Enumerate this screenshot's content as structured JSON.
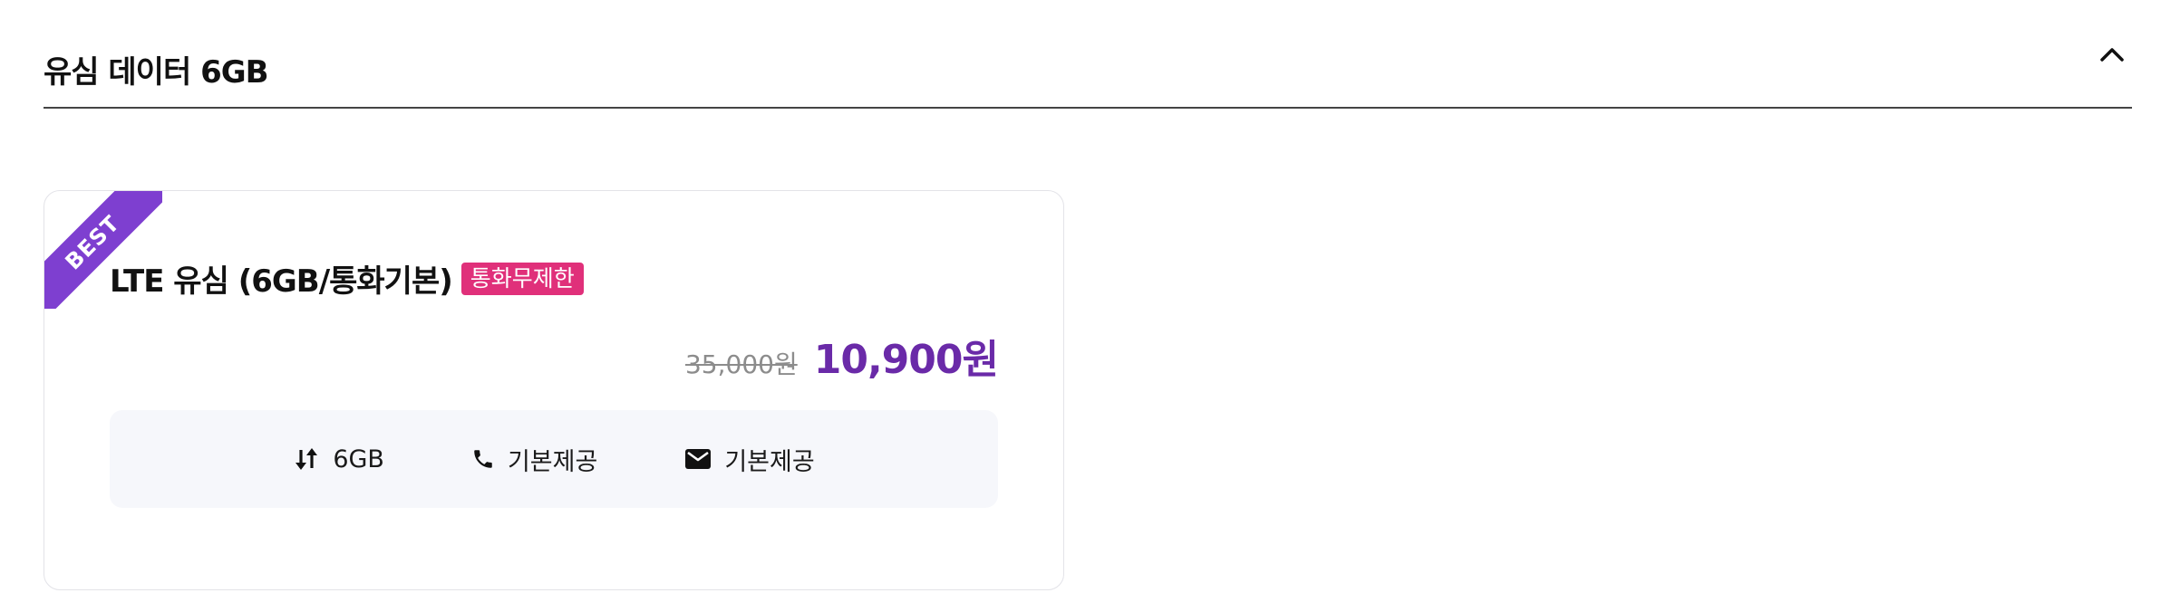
{
  "section": {
    "title": "유심 데이터 6GB",
    "collapse_icon": "chevron-up-icon"
  },
  "plan": {
    "ribbon": "BEST",
    "name": "LTE 유심 (6GB/통화기본)",
    "tag": "통화무제한",
    "original_price": "35,000원",
    "price": "10,900원",
    "features": [
      {
        "icon": "data-transfer-icon",
        "text": "6GB"
      },
      {
        "icon": "phone-icon",
        "text": "기본제공"
      },
      {
        "icon": "mail-icon",
        "text": "기본제공"
      }
    ]
  },
  "colors": {
    "ribbon": "#7e3fd0",
    "tag": "#e0307a",
    "price": "#6a2aa8"
  }
}
